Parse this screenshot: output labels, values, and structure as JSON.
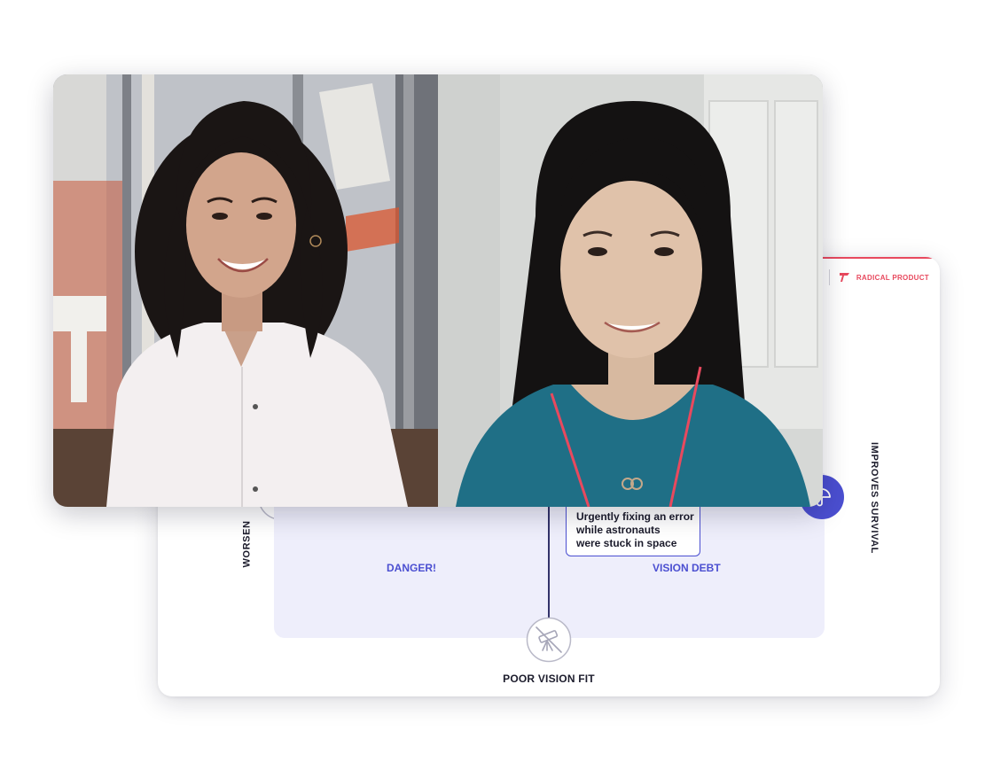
{
  "brand": {
    "name": "RADICAL PRODUCT",
    "accent": "#e8495e"
  },
  "matrix": {
    "quadrants": {
      "bottom_left": "DANGER!",
      "bottom_right": "VISION DEBT"
    },
    "axes": {
      "bottom": "POOR VISION FIT",
      "left_partial": "WORSEN",
      "right": "IMPROVES SURVIVAL"
    },
    "note": {
      "lines": [
        "Urgently fixing an error",
        "while astronauts",
        "were stuck in space"
      ]
    },
    "icons": {
      "bottom": "crossed-telescope-icon",
      "right": "umbrella-icon",
      "left": "crossed-icon"
    },
    "colors": {
      "quadrant_fill": "#eeeefb",
      "primary": "#4b4fd1",
      "axis_line": "#33336a"
    }
  },
  "video_call": {
    "participants": [
      {
        "tile": "left",
        "description_icon": "participant-video"
      },
      {
        "tile": "right",
        "description_icon": "participant-video"
      }
    ]
  }
}
